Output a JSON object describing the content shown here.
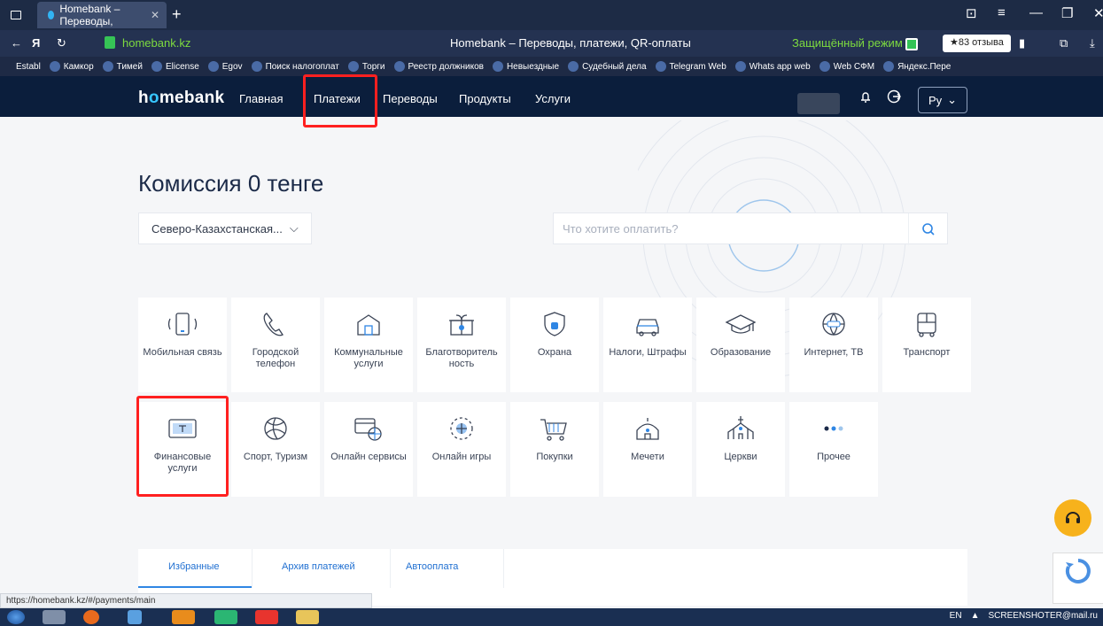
{
  "browser": {
    "tab_title": "Homebank – Переводы,",
    "url": "homebank.kz",
    "page_title": "Homebank – Переводы, платежи, QR-оплаты",
    "secure_mode": "Защищённый режим",
    "reviews": "★83 отзыва"
  },
  "bookmarks": [
    "Establ",
    "Камкор",
    "Тимей",
    "Elicense",
    "Egov",
    "Поиск налогоплат",
    "Торги",
    "Реестр должников",
    "Невыездные",
    "Судебный дела",
    "Telegram Web",
    "Whats app web",
    "Web СФМ",
    "Яндекс.Пере"
  ],
  "site": {
    "logo_pre": "h",
    "logo_o": "o",
    "logo_post": "mebank",
    "nav": [
      "Главная",
      "Платежи",
      "Переводы",
      "Продукты",
      "Услуги"
    ],
    "lang": "Ру"
  },
  "main": {
    "title": "Комиссия 0 тенге",
    "region": "Северо-Казахстанская...",
    "search_placeholder": "Что хотите оплатить?"
  },
  "categories": [
    {
      "label": "Мобильная связь",
      "icon": "mobile-icon"
    },
    {
      "label": "Городской телефон",
      "icon": "phone-icon"
    },
    {
      "label": "Коммунальные услуги",
      "icon": "house-icon"
    },
    {
      "label": "Благотворитель ность",
      "icon": "gift-icon"
    },
    {
      "label": "Охрана",
      "icon": "shield-icon"
    },
    {
      "label": "Налоги, Штрафы",
      "icon": "car-icon"
    },
    {
      "label": "Образование",
      "icon": "graduation-cap-icon"
    },
    {
      "label": "Интернет, ТВ",
      "icon": "globe-icon"
    },
    {
      "label": "Транспорт",
      "icon": "bus-icon"
    },
    {
      "label": "Финансовые услуги",
      "icon": "money-icon"
    },
    {
      "label": "Спорт, Туризм",
      "icon": "ball-icon"
    },
    {
      "label": "Онлайн сервисы",
      "icon": "card-globe-icon"
    },
    {
      "label": "Онлайн игры",
      "icon": "gamepad-globe-icon"
    },
    {
      "label": "Покупки",
      "icon": "cart-icon"
    },
    {
      "label": "Мечети",
      "icon": "mosque-icon"
    },
    {
      "label": "Церкви",
      "icon": "church-icon"
    },
    {
      "label": "Прочее",
      "icon": "dots-icon"
    }
  ],
  "bottom_tabs": [
    "Избранные",
    "Архив платежей",
    "Автооплата"
  ],
  "status_url": "https://homebank.kz/#/payments/main",
  "taskbar": {
    "lang": "EN",
    "brand": "SCREENSHOTER@mail.ru"
  },
  "colors": {
    "header": "#0b1e3c",
    "accent": "#37c6ff",
    "highlight": "#ff2020",
    "support": "#f7b21c"
  }
}
